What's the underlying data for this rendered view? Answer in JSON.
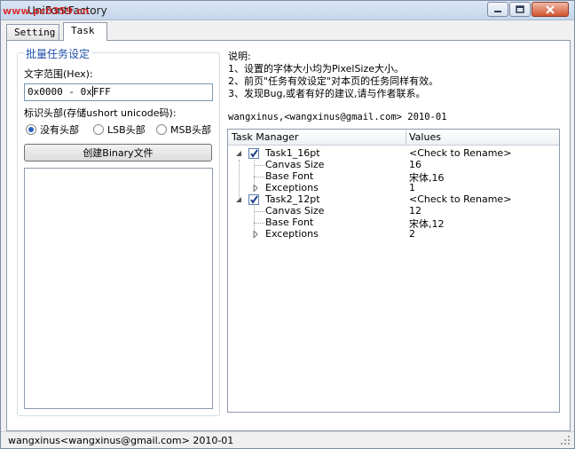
{
  "window": {
    "title": "UniFontFactory",
    "watermark": "www.pc0359.cn"
  },
  "tabs": [
    {
      "label": "Setting",
      "selected": false
    },
    {
      "label": "Task",
      "selected": true
    }
  ],
  "batch": {
    "group_title": "批量任务设定",
    "range_label": "文字范围(Hex):",
    "range_before": "0x0000 - 0x",
    "range_after": "FFF",
    "header_label": "标识头部(存储ushort unicode码):",
    "radios": [
      {
        "label": "没有头部",
        "selected": true
      },
      {
        "label": "LSB头部",
        "selected": false
      },
      {
        "label": "MSB头部",
        "selected": false
      }
    ],
    "create_button": "创建Binary文件"
  },
  "notes": {
    "heading": "说明:",
    "lines": [
      "1、设置的字体大小均为PixelSize大小。",
      "2、前页\"任务有效设定\"对本页的任务同样有效。",
      "3、发现Bug,或者有好的建议,请与作者联系。"
    ],
    "signature": "wangxinus,<wangxinus@gmail.com> 2010-01"
  },
  "task_tree": {
    "columns": [
      "Task Manager",
      "Values"
    ],
    "rows": [
      {
        "label": "Task1_16pt",
        "value": "<Check to Rename>"
      },
      {
        "label": "Canvas Size",
        "value": "16"
      },
      {
        "label": "Base Font",
        "value": "宋体,16"
      },
      {
        "label": "Exceptions",
        "value": "1"
      },
      {
        "label": "Task2_12pt",
        "value": "<Check to Rename>"
      },
      {
        "label": "Canvas Size",
        "value": "12"
      },
      {
        "label": "Base Font",
        "value": "宋体,12"
      },
      {
        "label": "Exceptions",
        "value": "2"
      }
    ]
  },
  "status": {
    "text": "wangxinus<wangxinus@gmail.com> 2010-01"
  },
  "icons": {
    "minimize": "minimize-icon",
    "maximize": "maximize-icon",
    "close": "close-icon",
    "expand": "expand-triangle-icon",
    "checkbox": "checkbox-checked-icon",
    "grip": "resize-grip-icon"
  }
}
